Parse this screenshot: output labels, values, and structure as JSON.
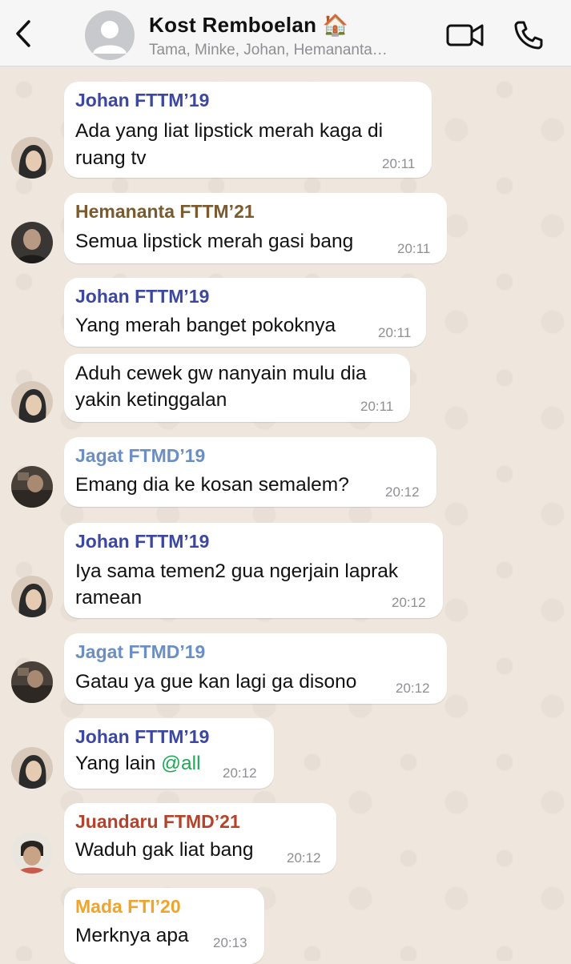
{
  "header": {
    "back_icon": "chevron-left-icon",
    "title": "Kost Remboelan 🏠",
    "subtitle": "Tama, Minke, Johan, Hemananta…",
    "video_icon": "video-call-icon",
    "phone_icon": "phone-icon"
  },
  "colors": {
    "johan": "#3b47a0",
    "hemananta": "#7a5a2f",
    "jagat": "#6b8fc2",
    "juandaru": "#b3432a",
    "mada": "#f0a429",
    "mention": "#1fa855"
  },
  "messages": [
    {
      "sender": "Johan FTTM’19",
      "lines": [
        "Ada yang liat lipstick merah kaga di",
        "ruang tv"
      ],
      "time": "20:11"
    },
    {
      "sender": "Hemananta FTTM’21",
      "lines": [
        "Semua lipstick merah gasi bang"
      ],
      "time": "20:11"
    },
    {
      "sender": "Johan FTTM’19",
      "lines": [
        "Yang merah banget pokoknya"
      ],
      "time": "20:11"
    },
    {
      "sender": "",
      "lines": [
        "Aduh cewek gw nanyain mulu dia",
        "yakin ketinggalan"
      ],
      "time": "20:11"
    },
    {
      "sender": "Jagat FTMD’19",
      "lines": [
        "Emang dia ke kosan semalem?"
      ],
      "time": "20:12"
    },
    {
      "sender": "Johan FTTM’19",
      "lines": [
        "Iya sama temen2 gua ngerjain laprak",
        "ramean"
      ],
      "time": "20:12"
    },
    {
      "sender": "Jagat FTMD’19",
      "lines": [
        "Gatau ya gue kan lagi ga disono"
      ],
      "time": "20:12"
    },
    {
      "sender": "Johan FTTM’19",
      "text_before_mention": "Yang lain ",
      "mention": "@all",
      "time": "20:12"
    },
    {
      "sender": "Juandaru FTMD’21",
      "lines": [
        "Waduh gak liat bang"
      ],
      "time": "20:12"
    },
    {
      "sender": "Mada FTI’20",
      "lines": [
        "Merknya apa"
      ],
      "time": "20:13"
    }
  ]
}
